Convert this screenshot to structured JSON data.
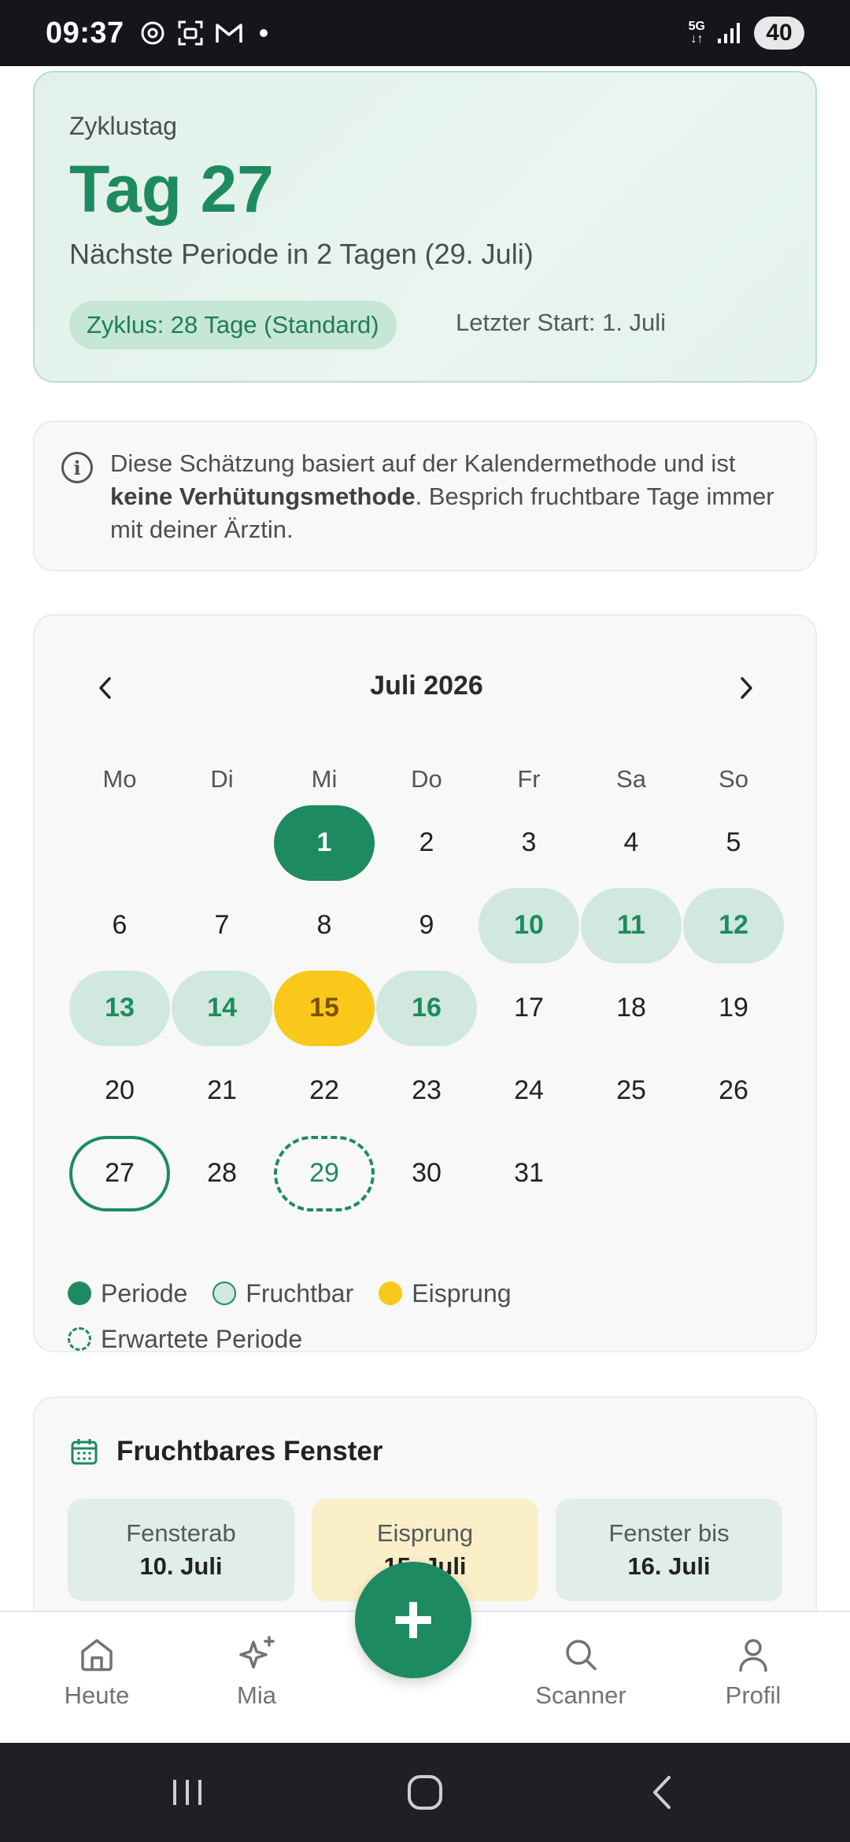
{
  "status_bar": {
    "time": "09:37",
    "battery": "40",
    "network": "5G"
  },
  "cycle": {
    "label": "Zyklustag",
    "day": "Tag 27",
    "next": "Nächste Periode in 2 Tagen (29. Juli)",
    "pill": "Zyklus: 28 Tage (Standard)",
    "last_start": "Letzter Start: 1. Juli"
  },
  "info": {
    "text_1": "Diese Schätzung basiert auf der Kalendermethode und ist ",
    "text_bold": "keine Verhütungsmethode",
    "text_2": ". Besprich fruchtbare Tage immer mit deiner Ärztin."
  },
  "calendar": {
    "title": "Juli 2026",
    "weekdays": [
      "Mo",
      "Di",
      "Mi",
      "Do",
      "Fr",
      "Sa",
      "So"
    ],
    "weeks": [
      [
        {
          "d": ""
        },
        {
          "d": ""
        },
        {
          "d": "1",
          "t": "period"
        },
        {
          "d": "2"
        },
        {
          "d": "3"
        },
        {
          "d": "4"
        },
        {
          "d": "5"
        }
      ],
      [
        {
          "d": "6"
        },
        {
          "d": "7"
        },
        {
          "d": "8"
        },
        {
          "d": "9"
        },
        {
          "d": "10",
          "t": "fertile"
        },
        {
          "d": "11",
          "t": "fertile"
        },
        {
          "d": "12",
          "t": "fertile"
        }
      ],
      [
        {
          "d": "13",
          "t": "fertile"
        },
        {
          "d": "14",
          "t": "fertile"
        },
        {
          "d": "15",
          "t": "ovulation"
        },
        {
          "d": "16",
          "t": "fertile"
        },
        {
          "d": "17"
        },
        {
          "d": "18"
        },
        {
          "d": "19"
        }
      ],
      [
        {
          "d": "20"
        },
        {
          "d": "21"
        },
        {
          "d": "22"
        },
        {
          "d": "23"
        },
        {
          "d": "24"
        },
        {
          "d": "25"
        },
        {
          "d": "26"
        }
      ],
      [
        {
          "d": "27",
          "t": "today"
        },
        {
          "d": "28"
        },
        {
          "d": "29",
          "t": "expected"
        },
        {
          "d": "30"
        },
        {
          "d": "31"
        },
        {
          "d": ""
        },
        {
          "d": ""
        }
      ]
    ],
    "legend": {
      "period": "Periode",
      "fertile": "Fruchtbar",
      "ovulation": "Eisprung",
      "expected": "Erwartete Periode"
    }
  },
  "fertile_window": {
    "title": "Fruchtbares Fenster",
    "boxes": [
      {
        "label": "Fensterab",
        "value": "10. Juli"
      },
      {
        "label": "Eisprung",
        "value": "15. Juli"
      },
      {
        "label": "Fenster bis",
        "value": "16. Juli"
      }
    ]
  },
  "nav": {
    "heute": "Heute",
    "mia": "Mia",
    "scanner": "Scanner",
    "profil": "Profil"
  },
  "colors": {
    "brand_green": "#1e8a62",
    "fertile_bg": "#d0e8de",
    "ovulation": "#f9c81b"
  }
}
